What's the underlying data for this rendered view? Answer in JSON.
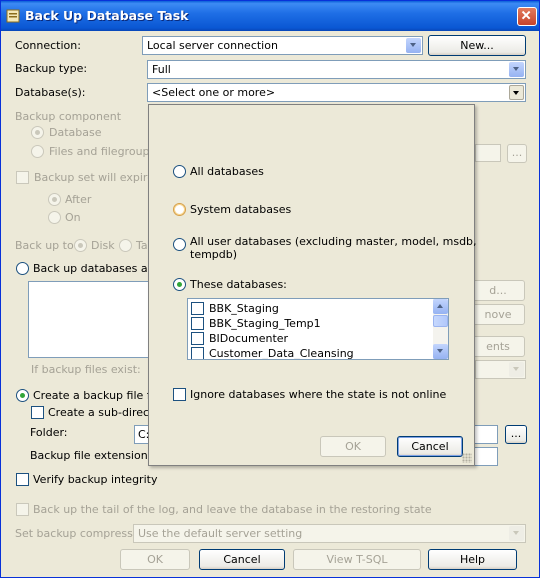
{
  "window": {
    "title": "Back Up Database Task"
  },
  "connection": {
    "label": "Connection:",
    "value": "Local server connection",
    "new_button": "New..."
  },
  "backup_type": {
    "label": "Backup type:",
    "value": "Full"
  },
  "databases": {
    "label": "Database(s):",
    "value": "<Select one or more>"
  },
  "backup_component": {
    "label": "Backup component",
    "options": [
      "Database",
      "Files and filegroups:"
    ],
    "browse_label": "..."
  },
  "backup_expire": {
    "label": "Backup set will expire:",
    "options": [
      "After",
      "On"
    ]
  },
  "backup_to": {
    "label": "Back up to:",
    "options": [
      "Disk",
      "Ta"
    ]
  },
  "across": {
    "label": "Back up databases across",
    "right_buttons": [
      "d...",
      "nove",
      "ents"
    ]
  },
  "if_exists": {
    "label": "If backup files exist:"
  },
  "create_file": {
    "label": "Create a backup file for ev",
    "subdir_label": "Create a sub-directory",
    "folder_label": "Folder:",
    "folder_value": "C:",
    "folder_browse": "...",
    "extension_label": "Backup file extension:"
  },
  "verify": {
    "label": "Verify backup integrity"
  },
  "tail_log": {
    "label": "Back up the tail of the log, and leave the database in the restoring state"
  },
  "compression": {
    "label": "Set backup compression:",
    "value": "Use the default server setting"
  },
  "footer": {
    "ok": "OK",
    "cancel": "Cancel",
    "tsql": "View T-SQL",
    "help": "Help"
  },
  "popup": {
    "options": {
      "all": "All databases",
      "system": "System databases",
      "user_line1": "All user databases  (excluding master, model, msdb,",
      "user_line2": "tempdb)",
      "these": "These databases:"
    },
    "list": [
      "BBK_Staging",
      "BBK_Staging_Temp1",
      "BIDocumenter",
      "Customer_Data_Cleansing"
    ],
    "ignore_label": "Ignore databases where the state is not online",
    "ok": "OK",
    "cancel": "Cancel"
  }
}
